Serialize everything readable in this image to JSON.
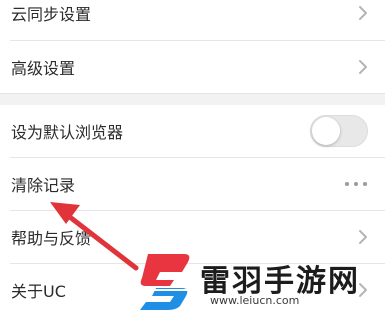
{
  "settings": {
    "items": [
      {
        "label": "云同步设置",
        "control": "chevron-right-icon"
      },
      {
        "label": "高级设置",
        "control": "chevron-right-icon"
      },
      {
        "label": "设为默认浏览器",
        "control": "toggle",
        "toggle_on": false
      },
      {
        "label": "清除记录",
        "control": "more-dots-icon"
      },
      {
        "label": "帮助与反馈",
        "control": "chevron-right-icon"
      },
      {
        "label": "关于UC",
        "control": "chevron-right-icon"
      }
    ]
  },
  "annotation": {
    "arrow_color": "#e0333a"
  },
  "watermark": {
    "title": "雷羽手游网",
    "url": "www.leiucn.com",
    "logo_colors": [
      "#e8353f",
      "#1f8fe6"
    ]
  },
  "colors": {
    "background": "#ffffff",
    "section_gap": "#f2f2f2",
    "divider": "#e6e6e6",
    "text": "#2b2b2b",
    "chevron": "#b5b5b5",
    "toggle_track": "#e8e8e8"
  }
}
